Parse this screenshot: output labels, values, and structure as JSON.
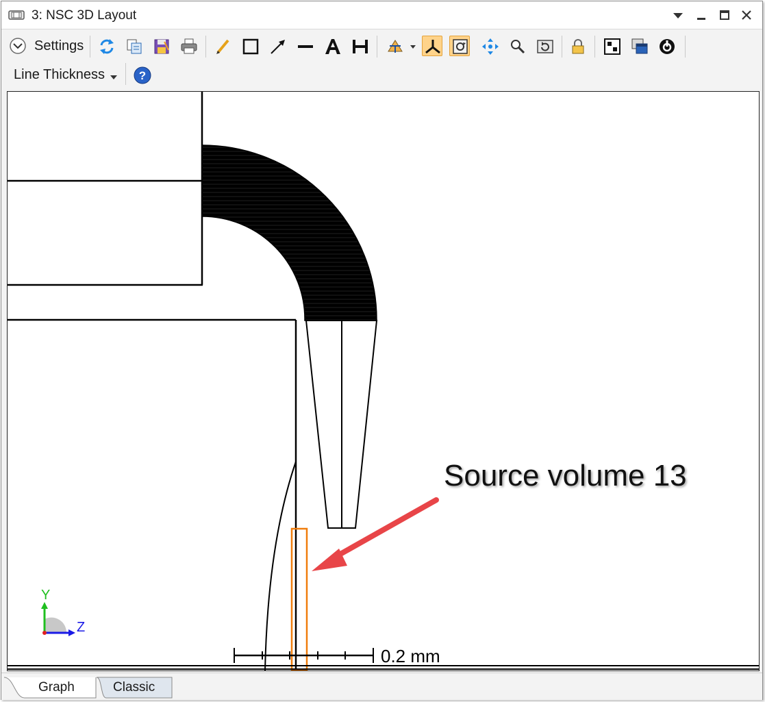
{
  "window": {
    "title": "3: NSC 3D Layout"
  },
  "toolbar": {
    "settings_label": "Settings",
    "line_thickness_label": "Line Thickness"
  },
  "plot": {
    "scale_bar_label": "0.2 mm",
    "axis_y_label": "Y",
    "axis_z_label": "Z",
    "annotation_text": "Source volume 13",
    "colors": {
      "source_volume": "#f07d0c",
      "annotation_arrow": "#e84548",
      "axis_y": "#1fbf1f",
      "axis_z": "#1a1ae6",
      "geometry": "#000000"
    }
  },
  "tabs": [
    {
      "label": "Graph",
      "active": true
    },
    {
      "label": "Classic",
      "active": false
    }
  ]
}
